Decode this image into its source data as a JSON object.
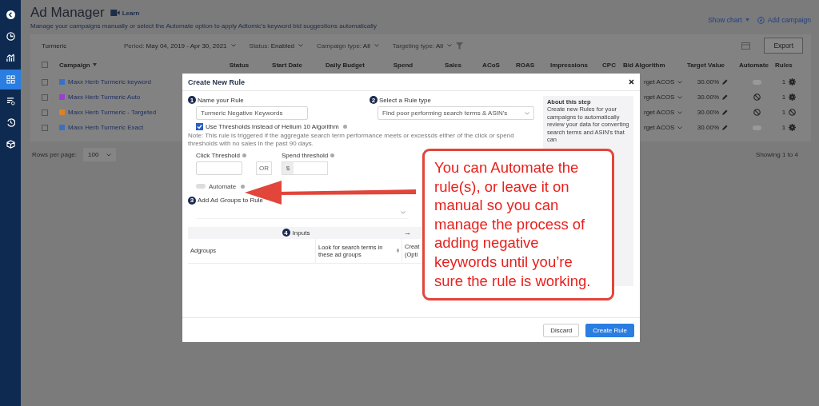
{
  "sidebar": {
    "items": [
      {
        "selected": false
      },
      {
        "selected": false
      },
      {
        "selected": false
      },
      {
        "selected": true
      },
      {
        "selected": false
      },
      {
        "selected": false
      },
      {
        "selected": false
      }
    ]
  },
  "header": {
    "title": "Ad Manager",
    "learn": "Learn",
    "subtitle": "Manage your campaigns manually or select the Automate option to apply Adtomic's keyword bid suggestions automatically",
    "show_chart": "Show chart",
    "add_campaign": "Add campaign"
  },
  "filters": {
    "search": "Turmeric",
    "period_label": "Period:",
    "period": "May 04, 2019 - Apr 30, 2021",
    "status_label": "Status:",
    "status": "Enabled",
    "campaign_type_label": "Campaign type:",
    "campaign_type": "All",
    "targeting_type_label": "Targeting type:",
    "targeting_type": "All",
    "export": "Export"
  },
  "table": {
    "select_all": {
      "checked": false
    },
    "columns": [
      "Campaign",
      "Status",
      "Start Date",
      "Daily Budget",
      "Spend",
      "Sales",
      "ACoS",
      "ROAS",
      "Impressions",
      "CPC",
      "Bid Algorithm",
      "Target Value",
      "Automate",
      "Rules"
    ],
    "rows": [
      {
        "selected": false,
        "color": "#3b6fc4",
        "name": "Maxx Herb Turmeric keyword",
        "bid_algorithm": "rget ACOS",
        "target_value": "30.00%",
        "automate": {
          "kind": "toggle",
          "on": false
        },
        "rules": {
          "count": "1",
          "kind": "gear"
        }
      },
      {
        "selected": false,
        "color": "#9b3fd0",
        "name": "Maxx Herb Turmeric Auto",
        "bid_algorithm": "rget ACOS",
        "target_value": "30.00%",
        "automate": {
          "kind": "blocked"
        },
        "rules": {
          "count": "1",
          "kind": "gear"
        }
      },
      {
        "selected": false,
        "color": "#d9822b",
        "name": "Maxx Herb Turmeric - Targeted",
        "bid_algorithm": "rget ACOS",
        "target_value": "30.00%",
        "automate": {
          "kind": "blocked"
        },
        "rules": {
          "count": "1",
          "kind": "blocked"
        }
      },
      {
        "selected": false,
        "color": "#3b6fc4",
        "name": "Maxx Herb Turmeric Exact",
        "bid_algorithm": "rget ACOS",
        "target_value": "30.00%",
        "automate": {
          "kind": "toggle",
          "on": false
        },
        "rules": {
          "count": "1",
          "kind": "gear"
        }
      }
    ]
  },
  "pagination": {
    "rows_per_page_label": "Rows per page:",
    "rows_per_page": "100",
    "showing": "Showing 1 to 4"
  },
  "modal": {
    "title": "Create New Rule",
    "step1": {
      "number": "1",
      "label": "Name your Rule",
      "value": "Turmeric Negative Keywords"
    },
    "step2": {
      "number": "2",
      "label": "Select a Rule type",
      "value": "Find poor performing search terms & ASIN's"
    },
    "use_thresholds": {
      "label": "Use Thresholds instead of Helium 10 Algorithm",
      "checked": true
    },
    "note": "Note: This rule is triggered if the aggregate search term performance meets or excessds either of the click or spend thresholds with no sales in the past 90 days.",
    "click_threshold": "Click Threshold",
    "or": "OR",
    "spend_threshold": "Spend threshold",
    "currency": "$",
    "automate": {
      "label": "Automate",
      "on": false
    },
    "step3": {
      "number": "3",
      "label": "Add Ad Groups to Rule"
    },
    "inputs": {
      "number": "4",
      "title": "Inputs",
      "arrow": "→",
      "columns": [
        "Adgroups",
        "Look for search terms in these ad groups",
        "Creat (Opti"
      ]
    },
    "about": {
      "title": "About this step",
      "text": "Create new Rules for your campaigns to automatically review your data for converting search terms and ASIN's that can"
    },
    "buttons": {
      "discard": "Discard",
      "create": "Create Rule"
    }
  },
  "callout": {
    "text": "You can Automate the rule(s), or leave it on manual so you can manage the process of adding negative keywords until you’re sure the rule is working."
  }
}
